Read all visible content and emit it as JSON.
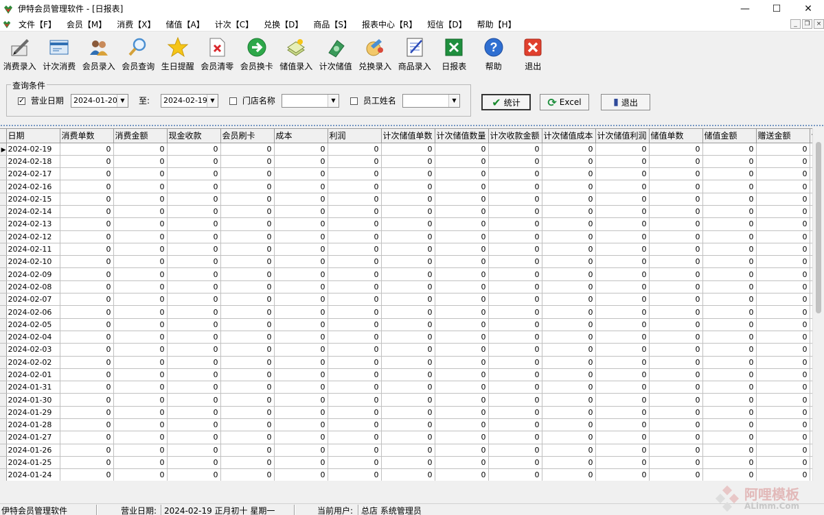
{
  "window": {
    "title": "伊特会员管理软件 - [日报表]",
    "min_glyph": "—",
    "max_glyph": "☐",
    "close_glyph": "✕"
  },
  "menu": [
    "文件【F】",
    "会员【M】",
    "消费【X】",
    "储值【A】",
    "计次【C】",
    "兑换【D】",
    "商品【S】",
    "报表中心【R】",
    "短信【D】",
    "帮助【H】"
  ],
  "mdi": {
    "min": "_",
    "restore": "❐",
    "close": "×"
  },
  "toolbar": [
    {
      "label": "消费录入",
      "icon": "pen-icon"
    },
    {
      "label": "计次消费",
      "icon": "card-icon"
    },
    {
      "label": "会员录入",
      "icon": "users-icon"
    },
    {
      "label": "会员查询",
      "icon": "magnifier-icon"
    },
    {
      "label": "生日提醒",
      "icon": "star-icon"
    },
    {
      "label": "会员清零",
      "icon": "doc-x-icon"
    },
    {
      "label": "会员换卡",
      "icon": "arrow-circle-icon"
    },
    {
      "label": "储值录入",
      "icon": "money-icon"
    },
    {
      "label": "计次储值",
      "icon": "cash-icon"
    },
    {
      "label": "兑换录入",
      "icon": "gift-icon"
    },
    {
      "label": "商品录入",
      "icon": "notebook-icon"
    },
    {
      "label": "日报表",
      "icon": "excel-icon"
    },
    {
      "label": "帮助",
      "icon": "help-icon"
    },
    {
      "label": "退出",
      "icon": "exit-icon"
    }
  ],
  "query": {
    "legend": "查询条件",
    "business_date_label": "营业日期",
    "business_date_checked": true,
    "date_from": "2024-01-20",
    "to_label": "至:",
    "date_to": "2024-02-19",
    "store_label": "门店名称",
    "store_checked": false,
    "store_value": "",
    "employee_label": "员工姓名",
    "employee_checked": false,
    "employee_value": ""
  },
  "buttons": {
    "stat": "统计",
    "excel": "Excel",
    "exit": "退出"
  },
  "grid": {
    "columns": [
      "日期",
      "消费单数",
      "消费金额",
      "现金收款",
      "会员刷卡",
      "成本",
      "利润",
      "计次储值单数",
      "计次储值数量",
      "计次收款金额",
      "计次储值成本",
      "计次储值利润",
      "储值单数",
      "储值金额",
      "赠送金额",
      "计"
    ],
    "rows": [
      {
        "date": "2024-02-19",
        "values": [
          "0",
          "0",
          "0",
          "0",
          "0",
          "0",
          "0",
          "0",
          "0",
          "0",
          "0",
          "0",
          "0",
          "0"
        ]
      },
      {
        "date": "2024-02-18",
        "values": [
          "0",
          "0",
          "0",
          "0",
          "0",
          "0",
          "0",
          "0",
          "0",
          "0",
          "0",
          "0",
          "0",
          "0"
        ]
      },
      {
        "date": "2024-02-17",
        "values": [
          "0",
          "0",
          "0",
          "0",
          "0",
          "0",
          "0",
          "0",
          "0",
          "0",
          "0",
          "0",
          "0",
          "0"
        ]
      },
      {
        "date": "2024-02-16",
        "values": [
          "0",
          "0",
          "0",
          "0",
          "0",
          "0",
          "0",
          "0",
          "0",
          "0",
          "0",
          "0",
          "0",
          "0"
        ]
      },
      {
        "date": "2024-02-15",
        "values": [
          "0",
          "0",
          "0",
          "0",
          "0",
          "0",
          "0",
          "0",
          "0",
          "0",
          "0",
          "0",
          "0",
          "0"
        ]
      },
      {
        "date": "2024-02-14",
        "values": [
          "0",
          "0",
          "0",
          "0",
          "0",
          "0",
          "0",
          "0",
          "0",
          "0",
          "0",
          "0",
          "0",
          "0"
        ]
      },
      {
        "date": "2024-02-13",
        "values": [
          "0",
          "0",
          "0",
          "0",
          "0",
          "0",
          "0",
          "0",
          "0",
          "0",
          "0",
          "0",
          "0",
          "0"
        ]
      },
      {
        "date": "2024-02-12",
        "values": [
          "0",
          "0",
          "0",
          "0",
          "0",
          "0",
          "0",
          "0",
          "0",
          "0",
          "0",
          "0",
          "0",
          "0"
        ]
      },
      {
        "date": "2024-02-11",
        "values": [
          "0",
          "0",
          "0",
          "0",
          "0",
          "0",
          "0",
          "0",
          "0",
          "0",
          "0",
          "0",
          "0",
          "0"
        ]
      },
      {
        "date": "2024-02-10",
        "values": [
          "0",
          "0",
          "0",
          "0",
          "0",
          "0",
          "0",
          "0",
          "0",
          "0",
          "0",
          "0",
          "0",
          "0"
        ]
      },
      {
        "date": "2024-02-09",
        "values": [
          "0",
          "0",
          "0",
          "0",
          "0",
          "0",
          "0",
          "0",
          "0",
          "0",
          "0",
          "0",
          "0",
          "0"
        ]
      },
      {
        "date": "2024-02-08",
        "values": [
          "0",
          "0",
          "0",
          "0",
          "0",
          "0",
          "0",
          "0",
          "0",
          "0",
          "0",
          "0",
          "0",
          "0"
        ]
      },
      {
        "date": "2024-02-07",
        "values": [
          "0",
          "0",
          "0",
          "0",
          "0",
          "0",
          "0",
          "0",
          "0",
          "0",
          "0",
          "0",
          "0",
          "0"
        ]
      },
      {
        "date": "2024-02-06",
        "values": [
          "0",
          "0",
          "0",
          "0",
          "0",
          "0",
          "0",
          "0",
          "0",
          "0",
          "0",
          "0",
          "0",
          "0"
        ]
      },
      {
        "date": "2024-02-05",
        "values": [
          "0",
          "0",
          "0",
          "0",
          "0",
          "0",
          "0",
          "0",
          "0",
          "0",
          "0",
          "0",
          "0",
          "0"
        ]
      },
      {
        "date": "2024-02-04",
        "values": [
          "0",
          "0",
          "0",
          "0",
          "0",
          "0",
          "0",
          "0",
          "0",
          "0",
          "0",
          "0",
          "0",
          "0"
        ]
      },
      {
        "date": "2024-02-03",
        "values": [
          "0",
          "0",
          "0",
          "0",
          "0",
          "0",
          "0",
          "0",
          "0",
          "0",
          "0",
          "0",
          "0",
          "0"
        ]
      },
      {
        "date": "2024-02-02",
        "values": [
          "0",
          "0",
          "0",
          "0",
          "0",
          "0",
          "0",
          "0",
          "0",
          "0",
          "0",
          "0",
          "0",
          "0"
        ]
      },
      {
        "date": "2024-02-01",
        "values": [
          "0",
          "0",
          "0",
          "0",
          "0",
          "0",
          "0",
          "0",
          "0",
          "0",
          "0",
          "0",
          "0",
          "0"
        ]
      },
      {
        "date": "2024-01-31",
        "values": [
          "0",
          "0",
          "0",
          "0",
          "0",
          "0",
          "0",
          "0",
          "0",
          "0",
          "0",
          "0",
          "0",
          "0"
        ]
      },
      {
        "date": "2024-01-30",
        "values": [
          "0",
          "0",
          "0",
          "0",
          "0",
          "0",
          "0",
          "0",
          "0",
          "0",
          "0",
          "0",
          "0",
          "0"
        ]
      },
      {
        "date": "2024-01-29",
        "values": [
          "0",
          "0",
          "0",
          "0",
          "0",
          "0",
          "0",
          "0",
          "0",
          "0",
          "0",
          "0",
          "0",
          "0"
        ]
      },
      {
        "date": "2024-01-28",
        "values": [
          "0",
          "0",
          "0",
          "0",
          "0",
          "0",
          "0",
          "0",
          "0",
          "0",
          "0",
          "0",
          "0",
          "0"
        ]
      },
      {
        "date": "2024-01-27",
        "values": [
          "0",
          "0",
          "0",
          "0",
          "0",
          "0",
          "0",
          "0",
          "0",
          "0",
          "0",
          "0",
          "0",
          "0"
        ]
      },
      {
        "date": "2024-01-26",
        "values": [
          "0",
          "0",
          "0",
          "0",
          "0",
          "0",
          "0",
          "0",
          "0",
          "0",
          "0",
          "0",
          "0",
          "0"
        ]
      },
      {
        "date": "2024-01-25",
        "values": [
          "0",
          "0",
          "0",
          "0",
          "0",
          "0",
          "0",
          "0",
          "0",
          "0",
          "0",
          "0",
          "0",
          "0"
        ]
      },
      {
        "date": "2024-01-24",
        "values": [
          "0",
          "0",
          "0",
          "0",
          "0",
          "0",
          "0",
          "0",
          "0",
          "0",
          "0",
          "0",
          "0",
          "0"
        ]
      }
    ]
  },
  "status": {
    "app_name": "伊特会员管理软件",
    "business_date_label": "营业日期:",
    "business_date": "2024-02-19  正月初十  星期一",
    "user_label": "当前用户:",
    "user": "总店 系统管理员"
  },
  "watermark": {
    "text": "阿哩模板",
    "sub": "ALimm.Com"
  },
  "colors": {
    "accent": "#0a5fc2",
    "grid_line": "#c0c0c0",
    "watermark": "#e2b9b9"
  }
}
